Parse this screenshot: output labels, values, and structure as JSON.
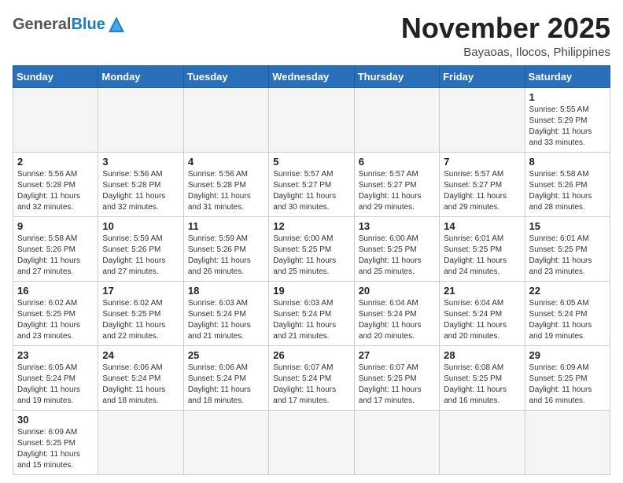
{
  "header": {
    "logo_general": "General",
    "logo_blue": "Blue",
    "month_title": "November 2025",
    "location": "Bayaoas, Ilocos, Philippines"
  },
  "days_of_week": [
    "Sunday",
    "Monday",
    "Tuesday",
    "Wednesday",
    "Thursday",
    "Friday",
    "Saturday"
  ],
  "weeks": [
    [
      {
        "day": "",
        "info": ""
      },
      {
        "day": "",
        "info": ""
      },
      {
        "day": "",
        "info": ""
      },
      {
        "day": "",
        "info": ""
      },
      {
        "day": "",
        "info": ""
      },
      {
        "day": "",
        "info": ""
      },
      {
        "day": "1",
        "info": "Sunrise: 5:55 AM\nSunset: 5:29 PM\nDaylight: 11 hours and 33 minutes."
      }
    ],
    [
      {
        "day": "2",
        "info": "Sunrise: 5:56 AM\nSunset: 5:28 PM\nDaylight: 11 hours and 32 minutes."
      },
      {
        "day": "3",
        "info": "Sunrise: 5:56 AM\nSunset: 5:28 PM\nDaylight: 11 hours and 32 minutes."
      },
      {
        "day": "4",
        "info": "Sunrise: 5:56 AM\nSunset: 5:28 PM\nDaylight: 11 hours and 31 minutes."
      },
      {
        "day": "5",
        "info": "Sunrise: 5:57 AM\nSunset: 5:27 PM\nDaylight: 11 hours and 30 minutes."
      },
      {
        "day": "6",
        "info": "Sunrise: 5:57 AM\nSunset: 5:27 PM\nDaylight: 11 hours and 29 minutes."
      },
      {
        "day": "7",
        "info": "Sunrise: 5:57 AM\nSunset: 5:27 PM\nDaylight: 11 hours and 29 minutes."
      },
      {
        "day": "8",
        "info": "Sunrise: 5:58 AM\nSunset: 5:26 PM\nDaylight: 11 hours and 28 minutes."
      }
    ],
    [
      {
        "day": "9",
        "info": "Sunrise: 5:58 AM\nSunset: 5:26 PM\nDaylight: 11 hours and 27 minutes."
      },
      {
        "day": "10",
        "info": "Sunrise: 5:59 AM\nSunset: 5:26 PM\nDaylight: 11 hours and 27 minutes."
      },
      {
        "day": "11",
        "info": "Sunrise: 5:59 AM\nSunset: 5:26 PM\nDaylight: 11 hours and 26 minutes."
      },
      {
        "day": "12",
        "info": "Sunrise: 6:00 AM\nSunset: 5:25 PM\nDaylight: 11 hours and 25 minutes."
      },
      {
        "day": "13",
        "info": "Sunrise: 6:00 AM\nSunset: 5:25 PM\nDaylight: 11 hours and 25 minutes."
      },
      {
        "day": "14",
        "info": "Sunrise: 6:01 AM\nSunset: 5:25 PM\nDaylight: 11 hours and 24 minutes."
      },
      {
        "day": "15",
        "info": "Sunrise: 6:01 AM\nSunset: 5:25 PM\nDaylight: 11 hours and 23 minutes."
      }
    ],
    [
      {
        "day": "16",
        "info": "Sunrise: 6:02 AM\nSunset: 5:25 PM\nDaylight: 11 hours and 23 minutes."
      },
      {
        "day": "17",
        "info": "Sunrise: 6:02 AM\nSunset: 5:25 PM\nDaylight: 11 hours and 22 minutes."
      },
      {
        "day": "18",
        "info": "Sunrise: 6:03 AM\nSunset: 5:24 PM\nDaylight: 11 hours and 21 minutes."
      },
      {
        "day": "19",
        "info": "Sunrise: 6:03 AM\nSunset: 5:24 PM\nDaylight: 11 hours and 21 minutes."
      },
      {
        "day": "20",
        "info": "Sunrise: 6:04 AM\nSunset: 5:24 PM\nDaylight: 11 hours and 20 minutes."
      },
      {
        "day": "21",
        "info": "Sunrise: 6:04 AM\nSunset: 5:24 PM\nDaylight: 11 hours and 20 minutes."
      },
      {
        "day": "22",
        "info": "Sunrise: 6:05 AM\nSunset: 5:24 PM\nDaylight: 11 hours and 19 minutes."
      }
    ],
    [
      {
        "day": "23",
        "info": "Sunrise: 6:05 AM\nSunset: 5:24 PM\nDaylight: 11 hours and 19 minutes."
      },
      {
        "day": "24",
        "info": "Sunrise: 6:06 AM\nSunset: 5:24 PM\nDaylight: 11 hours and 18 minutes."
      },
      {
        "day": "25",
        "info": "Sunrise: 6:06 AM\nSunset: 5:24 PM\nDaylight: 11 hours and 18 minutes."
      },
      {
        "day": "26",
        "info": "Sunrise: 6:07 AM\nSunset: 5:24 PM\nDaylight: 11 hours and 17 minutes."
      },
      {
        "day": "27",
        "info": "Sunrise: 6:07 AM\nSunset: 5:25 PM\nDaylight: 11 hours and 17 minutes."
      },
      {
        "day": "28",
        "info": "Sunrise: 6:08 AM\nSunset: 5:25 PM\nDaylight: 11 hours and 16 minutes."
      },
      {
        "day": "29",
        "info": "Sunrise: 6:09 AM\nSunset: 5:25 PM\nDaylight: 11 hours and 16 minutes."
      }
    ],
    [
      {
        "day": "30",
        "info": "Sunrise: 6:09 AM\nSunset: 5:25 PM\nDaylight: 11 hours and 15 minutes."
      },
      {
        "day": "",
        "info": ""
      },
      {
        "day": "",
        "info": ""
      },
      {
        "day": "",
        "info": ""
      },
      {
        "day": "",
        "info": ""
      },
      {
        "day": "",
        "info": ""
      },
      {
        "day": "",
        "info": ""
      }
    ]
  ]
}
